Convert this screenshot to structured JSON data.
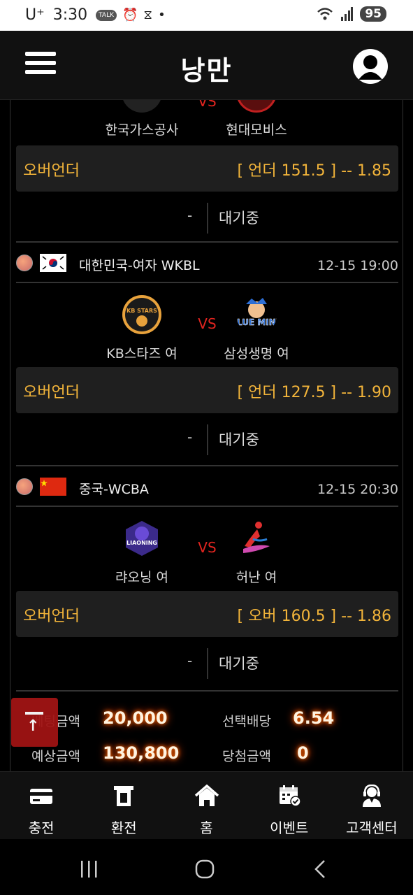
{
  "status_bar": {
    "carrier": "U⁺",
    "time": "3:30",
    "notif": "TALK",
    "dot": "•",
    "battery": "95"
  },
  "header": {
    "logo_text": "낭만"
  },
  "matches": [
    {
      "home": "한국가스공사",
      "away": "현대모비스",
      "vs": "VS",
      "ou_label": "오버언더",
      "ou_value": "[ 언더 151.5 ] -- 1.85",
      "score": "-",
      "status": "대기중"
    },
    {
      "league": "대한민국-여자 WKBL",
      "time": "12-15 19:00",
      "home": "KB스타즈 여",
      "away": "삼성생명 여",
      "vs": "VS",
      "home_logo_text": "KB STARS",
      "away_logo_text": "BLUE MINX",
      "ou_label": "오버언더",
      "ou_value": "[ 언더 127.5 ] -- 1.90",
      "score": "-",
      "status": "대기중"
    },
    {
      "league": "중국-WCBA",
      "time": "12-15 20:30",
      "home": "랴오닝 여",
      "away": "허난 여",
      "vs": "VS",
      "home_logo_text": "LIAONING",
      "ou_label": "오버언더",
      "ou_value": "[ 오버 160.5 ] -- 1.86",
      "score": "-",
      "status": "대기중"
    }
  ],
  "summary": {
    "bet_label": "베팅금액",
    "bet_value": "20,000",
    "odds_label": "선택배당",
    "odds_value": "6.54",
    "expected_label": "예상금액",
    "expected_value": "130,800",
    "win_label": "당첨금액",
    "win_value": "0"
  },
  "bottom_nav": [
    {
      "label": "충전",
      "icon": "card-icon"
    },
    {
      "label": "환전",
      "icon": "atm-icon"
    },
    {
      "label": "홈",
      "icon": "home-icon"
    },
    {
      "label": "이벤트",
      "icon": "calendar-icon"
    },
    {
      "label": "고객센터",
      "icon": "headset-icon"
    }
  ],
  "colors": {
    "accent_gold": "#f2b43a",
    "vs_red": "#e0241f",
    "totop_red": "#a01414"
  }
}
